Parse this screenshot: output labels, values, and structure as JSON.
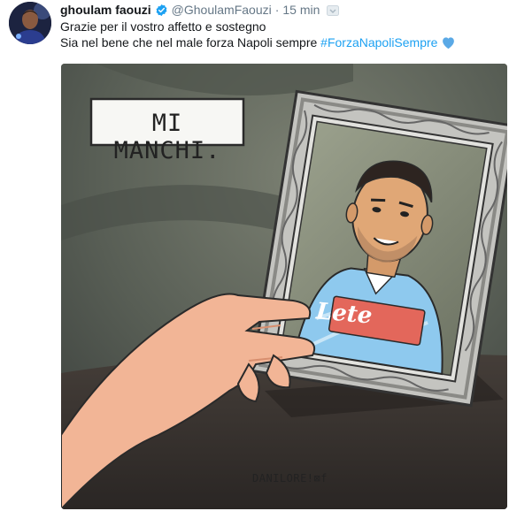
{
  "tweet": {
    "display_name": "ghoulam faouzi",
    "handle": "@GhoulamFaouzi",
    "separator": "·",
    "time": "15 min",
    "line1": "Grazie per il vostro affetto e sostegno",
    "line2_text": "Sia nel bene che nel male forza Napoli sempre ",
    "hashtag": "#ForzaNapoliSempre",
    "icons": {
      "verified": "verified-badge-icon",
      "caret": "chevron-down-icon",
      "heart": "blue-heart-icon"
    },
    "colors": {
      "link": "#1da1f2",
      "meta": "#657786",
      "verified": "#1da1f2",
      "heart": "#5aa9e6"
    }
  },
  "media": {
    "speech_bubble": "MI MANCHI.",
    "shirt_sponsor": "Lete",
    "artist_signature": "DANILORE!⊠f"
  }
}
